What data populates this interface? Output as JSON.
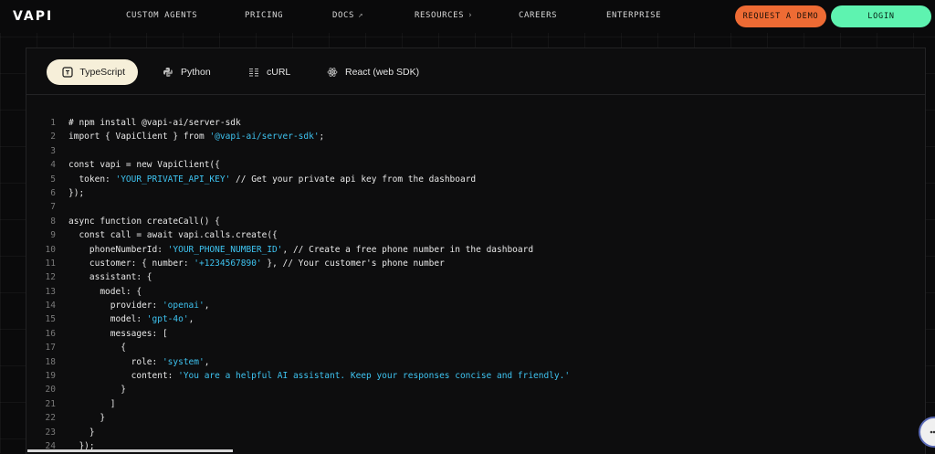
{
  "nav": {
    "logo": "VAPI",
    "items": [
      {
        "label": "CUSTOM AGENTS",
        "arrow": ""
      },
      {
        "label": "PRICING",
        "arrow": ""
      },
      {
        "label": "DOCS",
        "arrow": "↗"
      },
      {
        "label": "RESOURCES",
        "arrow": "›"
      },
      {
        "label": "CAREERS",
        "arrow": ""
      },
      {
        "label": "ENTERPRISE",
        "arrow": ""
      }
    ],
    "demo_label": "REQUEST A DEMO",
    "login_label": "LOGIN"
  },
  "colors": {
    "accent_orange": "#ee6b34",
    "accent_green": "#5ef3b0",
    "active_tab": "#f6efd9",
    "string": "#3ec3f0"
  },
  "tabs": [
    {
      "label": "TypeScript",
      "icon": "typescript-icon",
      "active": true
    },
    {
      "label": "Python",
      "icon": "python-icon",
      "active": false
    },
    {
      "label": "cURL",
      "icon": "curl-icon",
      "active": false
    },
    {
      "label": "React (web SDK)",
      "icon": "react-icon",
      "active": false
    }
  ],
  "code_lines": [
    {
      "n": "1",
      "parts": [
        {
          "t": "# npm install @vapi-ai/server-sdk",
          "s": false
        }
      ]
    },
    {
      "n": "2",
      "parts": [
        {
          "t": "import { VapiClient } from ",
          "s": false
        },
        {
          "t": "'@vapi-ai/server-sdk'",
          "s": true
        },
        {
          "t": ";",
          "s": false
        }
      ]
    },
    {
      "n": "3",
      "parts": []
    },
    {
      "n": "4",
      "parts": [
        {
          "t": "const vapi = new VapiClient({",
          "s": false
        }
      ]
    },
    {
      "n": "5",
      "parts": [
        {
          "t": "  token: ",
          "s": false
        },
        {
          "t": "'YOUR_PRIVATE_API_KEY'",
          "s": true
        },
        {
          "t": " // Get your private api key from the dashboard",
          "s": false
        }
      ]
    },
    {
      "n": "6",
      "parts": [
        {
          "t": "});",
          "s": false
        }
      ]
    },
    {
      "n": "7",
      "parts": []
    },
    {
      "n": "8",
      "parts": [
        {
          "t": "async function createCall() {",
          "s": false
        }
      ]
    },
    {
      "n": "9",
      "parts": [
        {
          "t": "  const call = await vapi.calls.create({",
          "s": false
        }
      ]
    },
    {
      "n": "10",
      "parts": [
        {
          "t": "    phoneNumberId: ",
          "s": false
        },
        {
          "t": "'YOUR_PHONE_NUMBER_ID'",
          "s": true
        },
        {
          "t": ", // Create a free phone number in the dashboard",
          "s": false
        }
      ]
    },
    {
      "n": "11",
      "parts": [
        {
          "t": "    customer: { number: ",
          "s": false
        },
        {
          "t": "'+1234567890'",
          "s": true
        },
        {
          "t": " }, // Your customer's phone number",
          "s": false
        }
      ]
    },
    {
      "n": "12",
      "parts": [
        {
          "t": "    assistant: {",
          "s": false
        }
      ]
    },
    {
      "n": "13",
      "parts": [
        {
          "t": "      model: {",
          "s": false
        }
      ]
    },
    {
      "n": "14",
      "parts": [
        {
          "t": "        provider: ",
          "s": false
        },
        {
          "t": "'openai'",
          "s": true
        },
        {
          "t": ",",
          "s": false
        }
      ]
    },
    {
      "n": "15",
      "parts": [
        {
          "t": "        model: ",
          "s": false
        },
        {
          "t": "'gpt-4o'",
          "s": true
        },
        {
          "t": ",",
          "s": false
        }
      ]
    },
    {
      "n": "16",
      "parts": [
        {
          "t": "        messages: [",
          "s": false
        }
      ]
    },
    {
      "n": "17",
      "parts": [
        {
          "t": "          {",
          "s": false
        }
      ]
    },
    {
      "n": "18",
      "parts": [
        {
          "t": "            role: ",
          "s": false
        },
        {
          "t": "'system'",
          "s": true
        },
        {
          "t": ",",
          "s": false
        }
      ]
    },
    {
      "n": "19",
      "parts": [
        {
          "t": "            content: ",
          "s": false
        },
        {
          "t": "'You are a helpful AI assistant. Keep your responses concise and friendly.'",
          "s": true
        }
      ]
    },
    {
      "n": "20",
      "parts": [
        {
          "t": "          }",
          "s": false
        }
      ]
    },
    {
      "n": "21",
      "parts": [
        {
          "t": "        ]",
          "s": false
        }
      ]
    },
    {
      "n": "22",
      "parts": [
        {
          "t": "      }",
          "s": false
        }
      ]
    },
    {
      "n": "23",
      "parts": [
        {
          "t": "    }",
          "s": false
        }
      ]
    },
    {
      "n": "24",
      "parts": [
        {
          "t": "  });",
          "s": false
        }
      ]
    }
  ]
}
